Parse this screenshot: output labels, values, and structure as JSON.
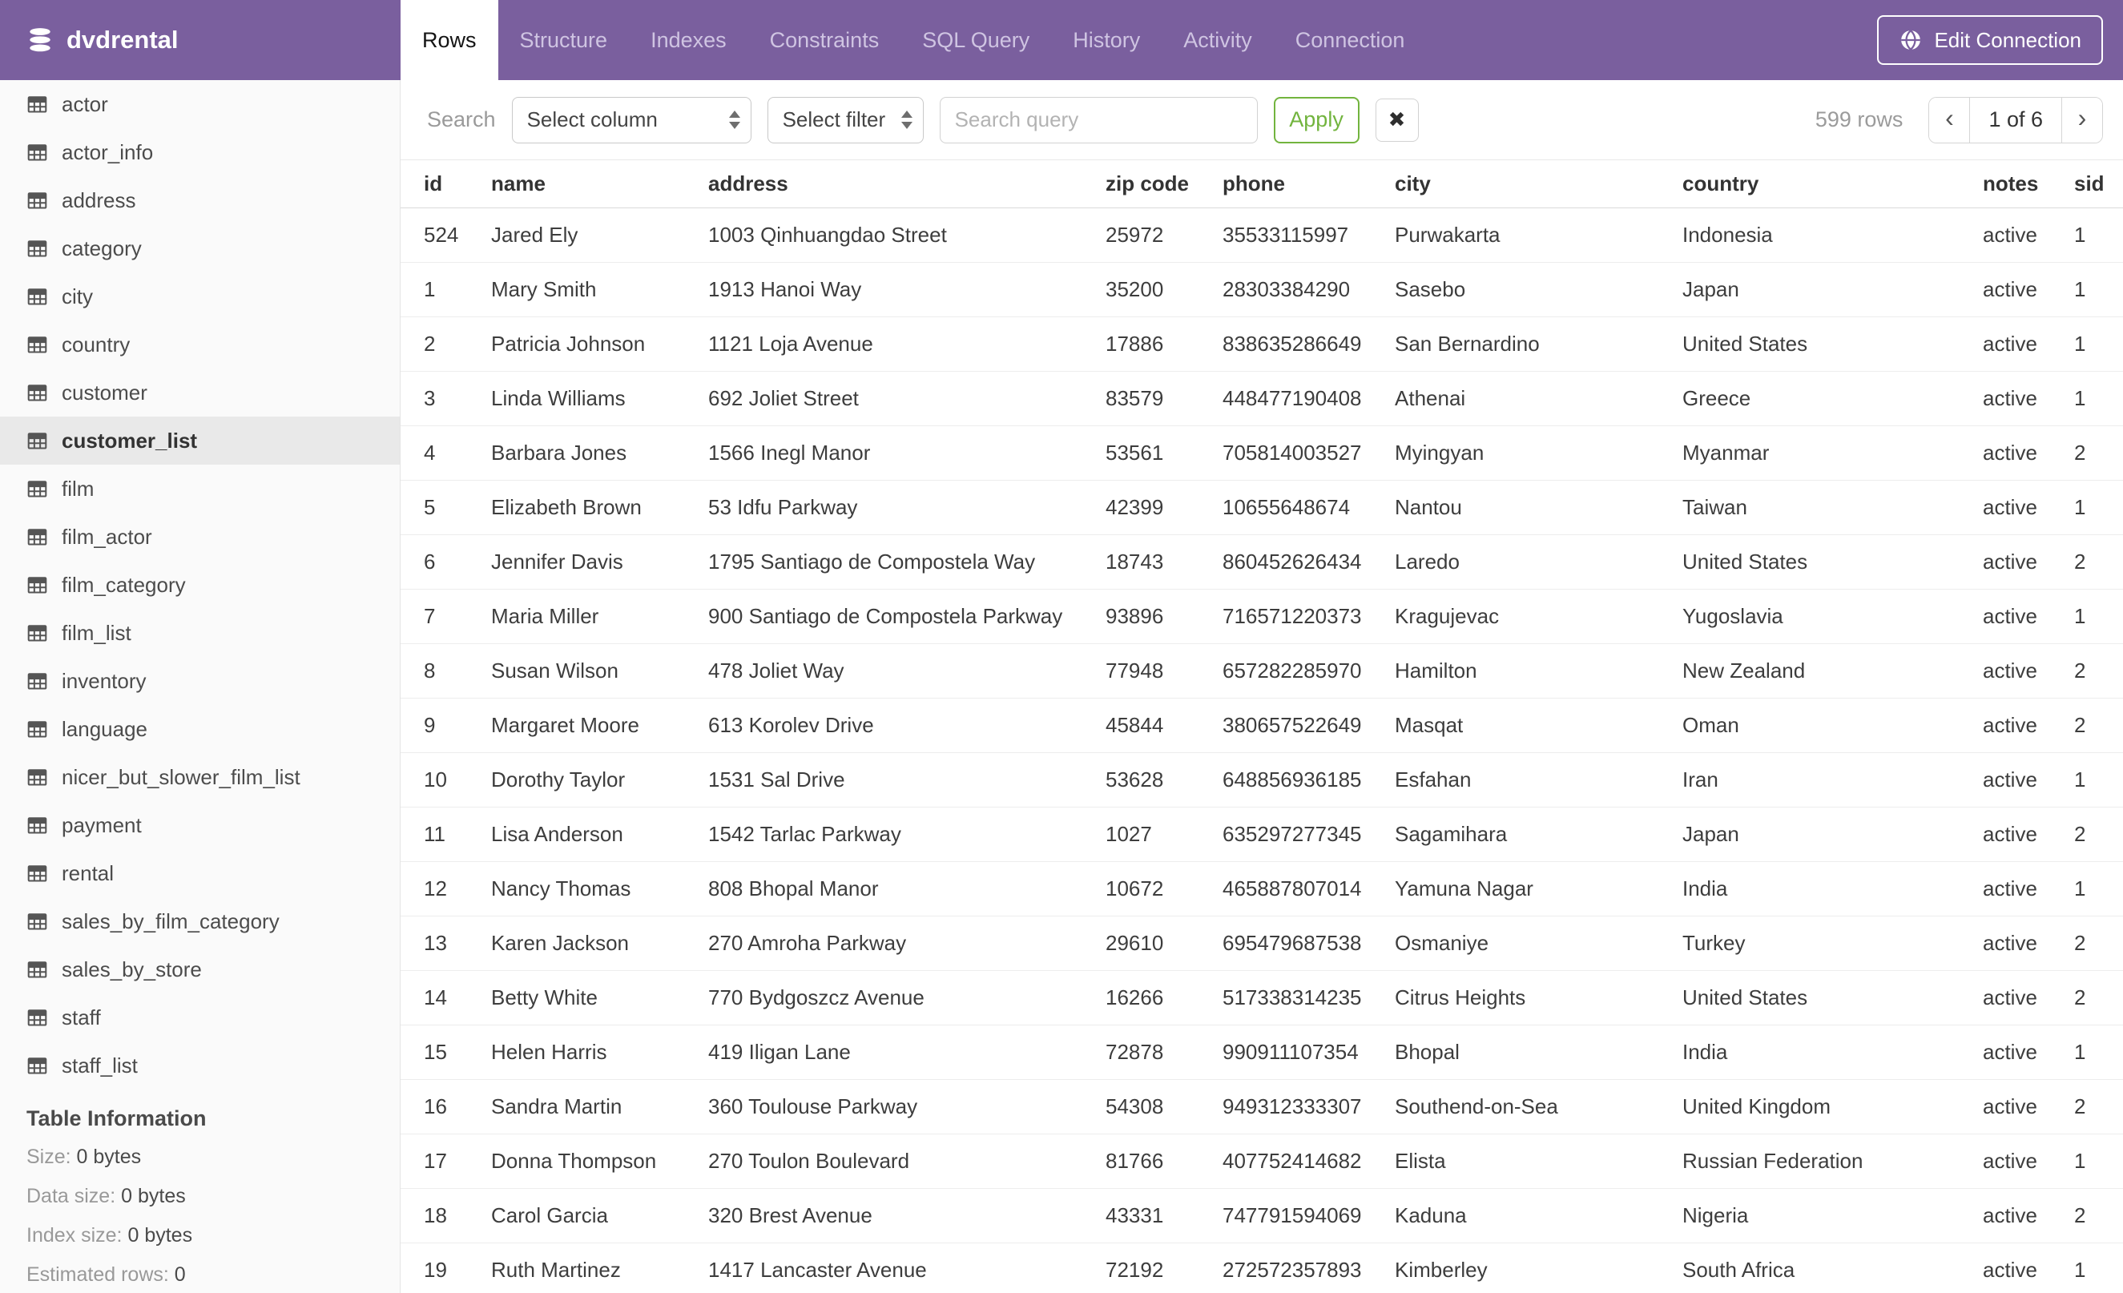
{
  "header": {
    "app_title": "dvdrental",
    "tabs": [
      {
        "label": "Rows",
        "active": true
      },
      {
        "label": "Structure",
        "active": false
      },
      {
        "label": "Indexes",
        "active": false
      },
      {
        "label": "Constraints",
        "active": false
      },
      {
        "label": "SQL Query",
        "active": false
      },
      {
        "label": "History",
        "active": false
      },
      {
        "label": "Activity",
        "active": false
      },
      {
        "label": "Connection",
        "active": false
      }
    ],
    "edit_connection_label": "Edit Connection"
  },
  "sidebar": {
    "tables": [
      "actor",
      "actor_info",
      "address",
      "category",
      "city",
      "country",
      "customer",
      "customer_list",
      "film",
      "film_actor",
      "film_category",
      "film_list",
      "inventory",
      "language",
      "nicer_but_slower_film_list",
      "payment",
      "rental",
      "sales_by_film_category",
      "sales_by_store",
      "staff",
      "staff_list"
    ],
    "selected": "customer_list",
    "table_information": {
      "title": "Table Information",
      "rows": [
        {
          "label": "Size:",
          "value": "0 bytes"
        },
        {
          "label": "Data size:",
          "value": "0 bytes"
        },
        {
          "label": "Index size:",
          "value": "0 bytes"
        },
        {
          "label": "Estimated rows:",
          "value": "0"
        }
      ]
    }
  },
  "toolbar": {
    "search_label": "Search",
    "select_column_value": "Select column",
    "select_filter_value": "Select filter",
    "query_placeholder": "Search query",
    "apply_label": "Apply",
    "clear_icon": "✖",
    "rows_count": "599 rows",
    "pagination": {
      "prev": "‹",
      "current": "1 of 6",
      "next": "›"
    }
  },
  "table": {
    "columns": [
      "id",
      "name",
      "address",
      "zip code",
      "phone",
      "city",
      "country",
      "notes",
      "sid"
    ],
    "rows": [
      [
        524,
        "Jared Ely",
        "1003 Qinhuangdao Street",
        "25972",
        "35533115997",
        "Purwakarta",
        "Indonesia",
        "active",
        1
      ],
      [
        1,
        "Mary Smith",
        "1913 Hanoi Way",
        "35200",
        "28303384290",
        "Sasebo",
        "Japan",
        "active",
        1
      ],
      [
        2,
        "Patricia Johnson",
        "1121 Loja Avenue",
        "17886",
        "838635286649",
        "San Bernardino",
        "United States",
        "active",
        1
      ],
      [
        3,
        "Linda Williams",
        "692 Joliet Street",
        "83579",
        "448477190408",
        "Athenai",
        "Greece",
        "active",
        1
      ],
      [
        4,
        "Barbara Jones",
        "1566 Inegl Manor",
        "53561",
        "705814003527",
        "Myingyan",
        "Myanmar",
        "active",
        2
      ],
      [
        5,
        "Elizabeth Brown",
        "53 Idfu Parkway",
        "42399",
        "10655648674",
        "Nantou",
        "Taiwan",
        "active",
        1
      ],
      [
        6,
        "Jennifer Davis",
        "1795 Santiago de Compostela Way",
        "18743",
        "860452626434",
        "Laredo",
        "United States",
        "active",
        2
      ],
      [
        7,
        "Maria Miller",
        "900 Santiago de Compostela Parkway",
        "93896",
        "716571220373",
        "Kragujevac",
        "Yugoslavia",
        "active",
        1
      ],
      [
        8,
        "Susan Wilson",
        "478 Joliet Way",
        "77948",
        "657282285970",
        "Hamilton",
        "New Zealand",
        "active",
        2
      ],
      [
        9,
        "Margaret Moore",
        "613 Korolev Drive",
        "45844",
        "380657522649",
        "Masqat",
        "Oman",
        "active",
        2
      ],
      [
        10,
        "Dorothy Taylor",
        "1531 Sal Drive",
        "53628",
        "648856936185",
        "Esfahan",
        "Iran",
        "active",
        1
      ],
      [
        11,
        "Lisa Anderson",
        "1542 Tarlac Parkway",
        "1027",
        "635297277345",
        "Sagamihara",
        "Japan",
        "active",
        2
      ],
      [
        12,
        "Nancy Thomas",
        "808 Bhopal Manor",
        "10672",
        "465887807014",
        "Yamuna Nagar",
        "India",
        "active",
        1
      ],
      [
        13,
        "Karen Jackson",
        "270 Amroha Parkway",
        "29610",
        "695479687538",
        "Osmaniye",
        "Turkey",
        "active",
        2
      ],
      [
        14,
        "Betty White",
        "770 Bydgoszcz Avenue",
        "16266",
        "517338314235",
        "Citrus Heights",
        "United States",
        "active",
        2
      ],
      [
        15,
        "Helen Harris",
        "419 Iligan Lane",
        "72878",
        "990911107354",
        "Bhopal",
        "India",
        "active",
        1
      ],
      [
        16,
        "Sandra Martin",
        "360 Toulouse Parkway",
        "54308",
        "949312333307",
        "Southend-on-Sea",
        "United Kingdom",
        "active",
        2
      ],
      [
        17,
        "Donna Thompson",
        "270 Toulon Boulevard",
        "81766",
        "407752414682",
        "Elista",
        "Russian Federation",
        "active",
        1
      ],
      [
        18,
        "Carol Garcia",
        "320 Brest Avenue",
        "43331",
        "747791594069",
        "Kaduna",
        "Nigeria",
        "active",
        2
      ],
      [
        19,
        "Ruth Martinez",
        "1417 Lancaster Avenue",
        "72192",
        "272572357893",
        "Kimberley",
        "South Africa",
        "active",
        1
      ]
    ]
  },
  "icons": {
    "logo": "database-icon",
    "sidebar_item": "table-grid-icon",
    "edit_connection": "globe-icon",
    "select_arrows": "up-down-arrows-icon",
    "clear": "✖",
    "pager_prev": "‹",
    "pager_next": "›"
  },
  "colors": {
    "header_purple": "#7a5f9e",
    "tab_inactive_text": "#cfc4e2",
    "apply_green": "#72b43e",
    "selected_item_bg": "#e9e9e9",
    "sidebar_bg": "#fafafa",
    "muted_text": "#9b9b9b",
    "row_border": "#ededed"
  }
}
